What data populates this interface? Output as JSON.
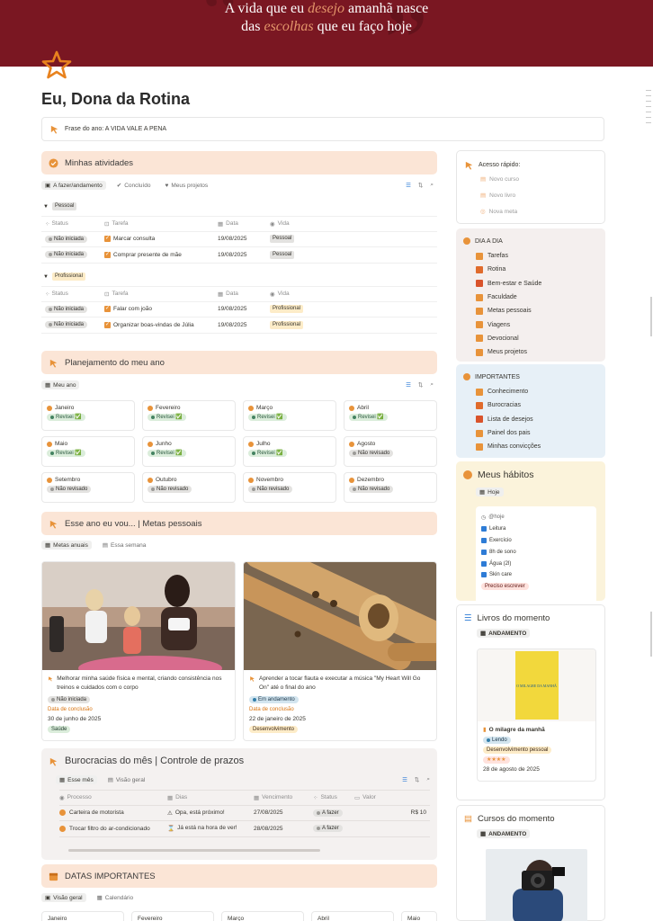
{
  "banner": {
    "line1_a": "A vida que eu",
    "line1_hl": "desejo",
    "line1_b": "amanhã nasce",
    "line2_a": "das",
    "line2_hl": "escolhas",
    "line2_b": "que eu faço hoje"
  },
  "page": {
    "title": "Eu, Dona da Rotina",
    "icon": "star-icon"
  },
  "phrase": "Frase do ano: A VIDA VALE A PENA",
  "atividades": {
    "title": "Minhas atividades",
    "tabs": [
      "A fazer/andamento",
      "Concluído",
      "Meus projetos"
    ],
    "columns": [
      "Status",
      "Tarefa",
      "Data",
      "Vida"
    ],
    "groups": [
      {
        "name": "Pessoal",
        "rows": [
          {
            "status": "Não iniciada",
            "tarefa": "Marcar consulta",
            "data": "19/08/2025",
            "vida": "Pessoal"
          },
          {
            "status": "Não iniciada",
            "tarefa": "Comprar presente de mãe",
            "data": "19/08/2025",
            "vida": "Pessoal"
          }
        ]
      },
      {
        "name": "Profissional",
        "rows": [
          {
            "status": "Não iniciada",
            "tarefa": "Falar com joão",
            "data": "19/08/2025",
            "vida": "Profissional"
          },
          {
            "status": "Não iniciada",
            "tarefa": "Organizar boas-vindas de Júlia",
            "data": "19/08/2025",
            "vida": "Profissional"
          }
        ]
      }
    ]
  },
  "planejamento": {
    "title": "Planejamento do meu ano",
    "tab": "Meu ano",
    "months": [
      {
        "name": "Janeiro",
        "status": "Revisei ✅",
        "done": true
      },
      {
        "name": "Fevereiro",
        "status": "Revisei ✅",
        "done": true
      },
      {
        "name": "Março",
        "status": "Revisei ✅",
        "done": true
      },
      {
        "name": "Abril",
        "status": "Revisei ✅",
        "done": true
      },
      {
        "name": "Maio",
        "status": "Revisei ✅",
        "done": true
      },
      {
        "name": "Junho",
        "status": "Revisei ✅",
        "done": true
      },
      {
        "name": "Julho",
        "status": "Revisei ✅",
        "done": true
      },
      {
        "name": "Agosto",
        "status": "Não revisado",
        "done": false
      },
      {
        "name": "Setembro",
        "status": "Não revisado",
        "done": false
      },
      {
        "name": "Outubro",
        "status": "Não revisado",
        "done": false
      },
      {
        "name": "Novembro",
        "status": "Não revisado",
        "done": false
      },
      {
        "name": "Dezembro",
        "status": "Não revisado",
        "done": false
      }
    ]
  },
  "metas": {
    "title": "Esse ano eu vou... | Metas pessoais",
    "tabs": [
      "Metas anuais",
      "Essa semana"
    ],
    "cards": [
      {
        "title": "Melhorar minha saúde física e mental, criando consistência nos treinos e cuidados com o corpo",
        "status": "Não iniciada",
        "date_label": "Data de conclusão",
        "date": "30 de junho de 2025",
        "tag": "Saúde"
      },
      {
        "title": "Aprender a tocar flauta e executar a música \"My Heart Will Go On\" até o final do ano",
        "status": "Em andamento",
        "date_label": "Data de conclusão",
        "date": "22 de janeiro de 2025",
        "tag": "Desenvolvimento"
      }
    ]
  },
  "burocracias": {
    "title": "Burocracias do mês | Controle de prazos",
    "tabs": [
      "Esse mês",
      "Visão geral"
    ],
    "columns": [
      "Processo",
      "Dias",
      "Vencimento",
      "Status",
      "Valor"
    ],
    "rows": [
      {
        "processo": "Carteira de motorista",
        "dias": "Opa, está próximo!",
        "vencimento": "27/08/2025",
        "status": "A fazer",
        "valor": "R$ 10"
      },
      {
        "processo": "Trocar filtro do ar-condicionado",
        "dias": "Já está na hora de ver!",
        "vencimento": "28/08/2025",
        "status": "A fazer",
        "valor": ""
      }
    ]
  },
  "datas": {
    "title": "DATAS IMPORTANTES",
    "tabs": [
      "Visão geral",
      "Calendário"
    ],
    "months": [
      "Janeiro",
      "Fevereiro",
      "Março",
      "Abril",
      "Maio"
    ]
  },
  "acesso": {
    "title": "Acesso rápido:",
    "buttons": [
      "Novo curso",
      "Novo livro",
      "Nova meta"
    ]
  },
  "dia": {
    "title": "DIA A DIA",
    "items": [
      "Tarefas",
      "Rotina",
      "Bem-estar e Saúde",
      "Faculdade",
      "Metas pessoais",
      "Viagens",
      "Devocional",
      "Meus projetos"
    ]
  },
  "importantes": {
    "title": "IMPORTANTES",
    "items": [
      "Conhecimento",
      "Burocracias",
      "Lista de desejos",
      "Painel dos pais",
      "Minhas convicções"
    ]
  },
  "habitos": {
    "title": "Meus hábitos",
    "tab": "Hoje",
    "card_title": "@hoje",
    "items": [
      "Leitura",
      "Exercício",
      "8h de sono",
      "Água (2l)",
      "Skin care"
    ],
    "badge": "Preciso escrever"
  },
  "livros": {
    "title": "Livros do momento",
    "tab": "ANDAMENTO",
    "cover_title": "O MILAGRE DA MANHÃ",
    "book": {
      "title": "O milagre da manhã",
      "status": "Lendo",
      "category": "Desenvolvimento pessoal",
      "rating": "★★★★",
      "date": "28 de agosto de 2025"
    }
  },
  "cursos": {
    "title": "Cursos do momento",
    "tab": "ANDAMENTO"
  },
  "colors": {
    "banner": "#7a1722",
    "accent": "#e8933a",
    "section": "#fbe5d6"
  }
}
